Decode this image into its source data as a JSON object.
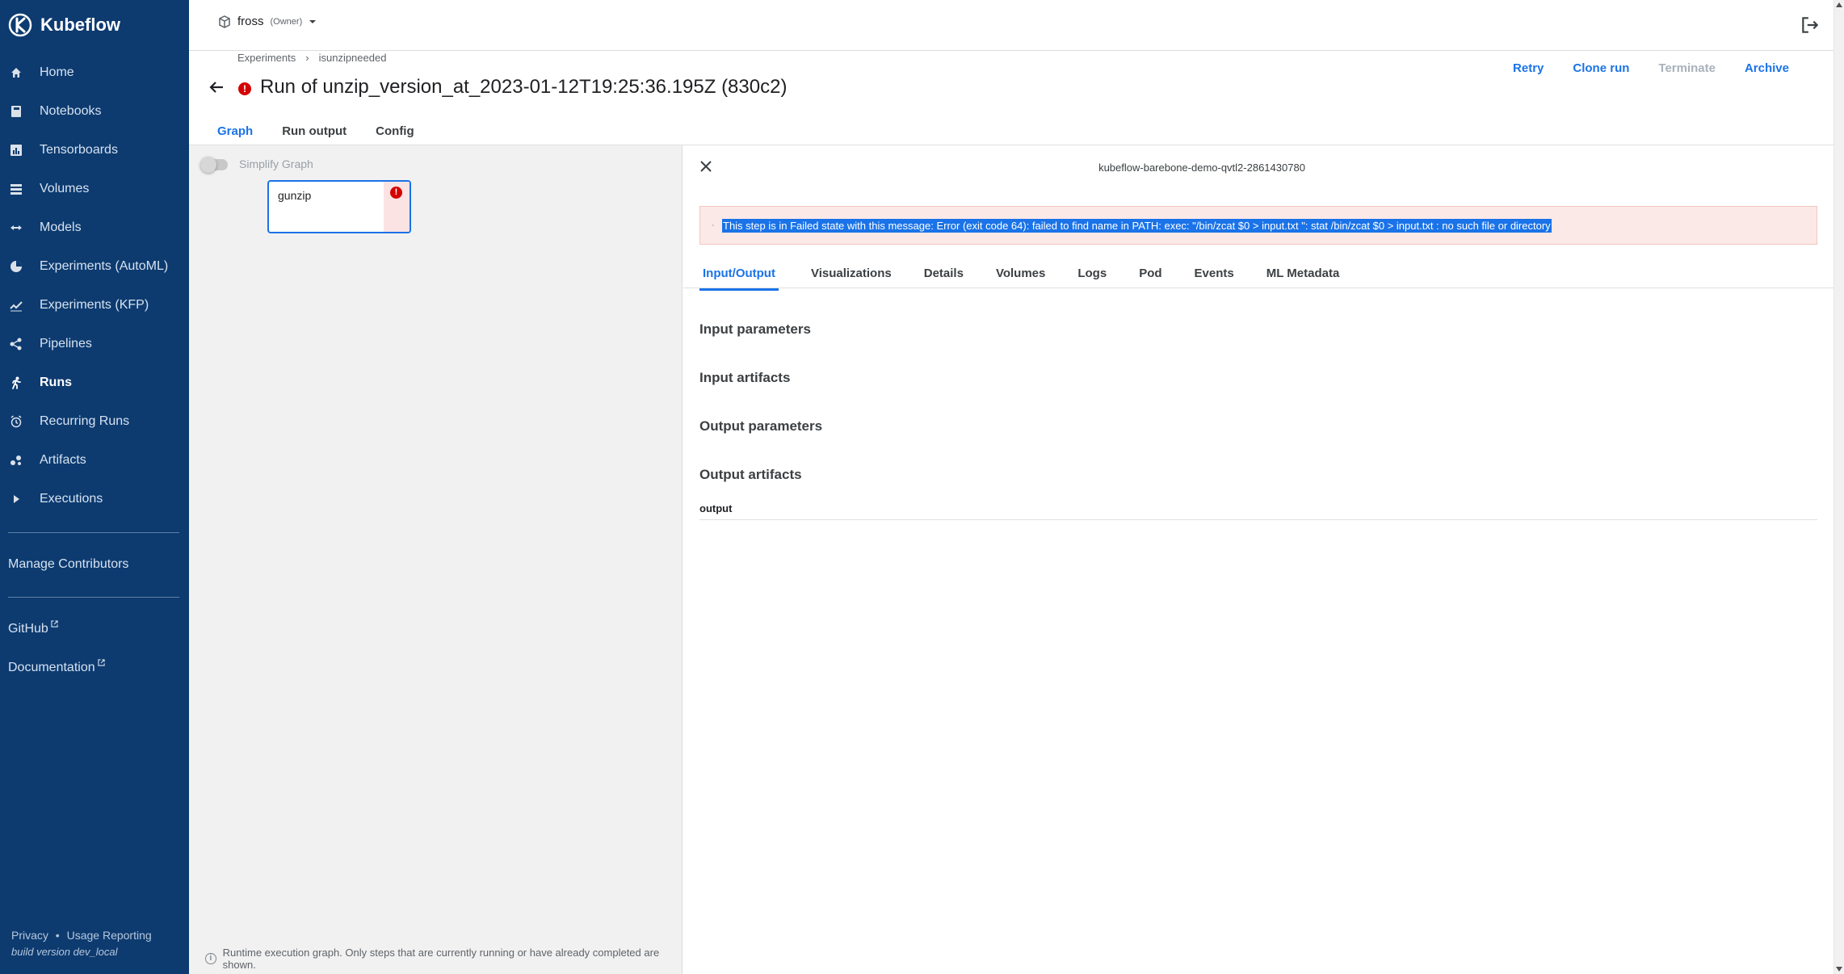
{
  "brand": {
    "name": "Kubeflow"
  },
  "sidebar": {
    "items": [
      {
        "label": "Home",
        "icon": "home-icon"
      },
      {
        "label": "Notebooks",
        "icon": "notebook-icon"
      },
      {
        "label": "Tensorboards",
        "icon": "tensorboard-icon"
      },
      {
        "label": "Volumes",
        "icon": "volumes-icon"
      },
      {
        "label": "Models",
        "icon": "models-icon"
      },
      {
        "label": "Experiments (AutoML)",
        "icon": "automl-icon"
      },
      {
        "label": "Experiments (KFP)",
        "icon": "kfp-icon"
      },
      {
        "label": "Pipelines",
        "icon": "pipelines-icon"
      },
      {
        "label": "Runs",
        "icon": "runs-icon",
        "active": true
      },
      {
        "label": "Recurring Runs",
        "icon": "alarm-icon"
      },
      {
        "label": "Artifacts",
        "icon": "artifacts-icon"
      },
      {
        "label": "Executions",
        "icon": "play-icon"
      }
    ],
    "manage_contributors": "Manage Contributors",
    "github": "GitHub",
    "documentation": "Documentation",
    "privacy": "Privacy",
    "bullet": "•",
    "usage_reporting": "Usage Reporting",
    "build_version": "build version dev_local"
  },
  "topbar": {
    "namespace": "fross",
    "role": "(Owner)"
  },
  "breadcrumb": {
    "items": [
      "Experiments",
      "isunzipneeded"
    ],
    "separator": "›"
  },
  "run": {
    "title": "Run of unzip_version_at_2023-01-12T19:25:36.195Z (830c2)"
  },
  "actions": {
    "retry": "Retry",
    "clone": "Clone run",
    "terminate": "Terminate",
    "archive": "Archive"
  },
  "main_tabs": [
    "Graph",
    "Run output",
    "Config"
  ],
  "graph": {
    "simplify_label": "Simplify Graph",
    "node_label": "gunzip",
    "note": "Runtime execution graph. Only steps that are currently running or have already completed are shown."
  },
  "panel": {
    "node_id": "kubeflow-barebone-demo-qvtl2-2861430780",
    "error_message": "This step is in Failed state with this message: Error (exit code 64): failed to find name in PATH: exec: \"/bin/zcat $0 > input.txt \": stat /bin/zcat $0 > input.txt : no such file or directory",
    "tabs": [
      "Input/Output",
      "Visualizations",
      "Details",
      "Volumes",
      "Logs",
      "Pod",
      "Events",
      "ML Metadata"
    ],
    "sections": {
      "input_parameters": "Input parameters",
      "input_artifacts": "Input artifacts",
      "output_parameters": "Output parameters",
      "output_artifacts": "Output artifacts"
    },
    "output_artifact_name": "output"
  },
  "colors": {
    "sidebar": "#0d3b70",
    "accent": "#1a73e8",
    "error": "#d50000"
  }
}
